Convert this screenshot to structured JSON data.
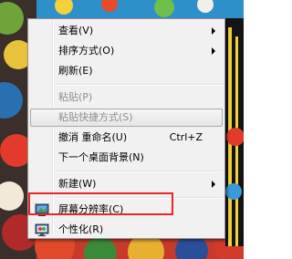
{
  "menu": {
    "items": [
      {
        "label": "查看(V)",
        "submenu": true
      },
      {
        "label": "排序方式(O)",
        "submenu": true
      },
      {
        "label": "刷新(E)"
      },
      {
        "label": "粘贴(P)",
        "disabled": true
      },
      {
        "label": "粘贴快捷方式(S)",
        "disabled": true
      },
      {
        "label": "撤消 重命名(U)",
        "shortcut": "Ctrl+Z"
      },
      {
        "label": "下一个桌面背景(N)"
      },
      {
        "label": "新建(W)",
        "submenu": true
      },
      {
        "label": "屏幕分辨率(C)",
        "icon": "display-icon"
      },
      {
        "label": "个性化(R)",
        "icon": "personalize-icon"
      }
    ]
  },
  "annotation": {
    "color": "#e8262b",
    "target": "屏幕分辨率(C)"
  }
}
